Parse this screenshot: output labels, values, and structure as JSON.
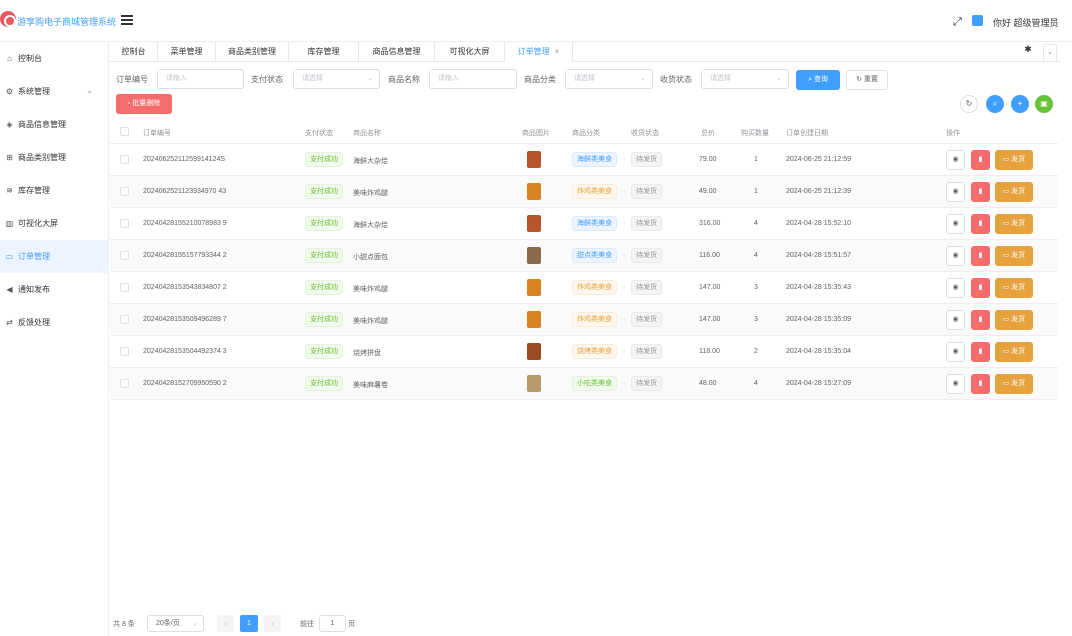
{
  "app": {
    "title": "游享购电子商城管理系统",
    "greeting": "你好 超级管理员"
  },
  "sidebar": {
    "items": [
      {
        "label": "控制台",
        "icon": "home-icon"
      },
      {
        "label": "系统管理",
        "icon": "gear-icon"
      },
      {
        "label": "商品信息管理",
        "icon": "box-icon"
      },
      {
        "label": "商品类别管理",
        "icon": "grid-icon"
      },
      {
        "label": "库存管理",
        "icon": "database-icon"
      },
      {
        "label": "可视化大屏",
        "icon": "chart-icon"
      },
      {
        "label": "订单管理",
        "icon": "card-icon"
      },
      {
        "label": "通知发布",
        "icon": "speaker-icon"
      },
      {
        "label": "反馈处理",
        "icon": "swap-icon"
      }
    ],
    "active": "订单管理"
  },
  "tabs": [
    {
      "label": "控制台"
    },
    {
      "label": "菜单管理"
    },
    {
      "label": "商品类别管理"
    },
    {
      "label": "库存管理"
    },
    {
      "label": "商品信息管理"
    },
    {
      "label": "可视化大屏"
    },
    {
      "label": "订单管理"
    }
  ],
  "filters": {
    "order_no": {
      "label": "订单编号",
      "placeholder": "请输入"
    },
    "pay_status": {
      "label": "支付状态",
      "placeholder": "请选择"
    },
    "product_name": {
      "label": "商品名称",
      "placeholder": "请输入"
    },
    "category": {
      "label": "商品分类",
      "placeholder": "请选择"
    },
    "receive_status": {
      "label": "收货状态",
      "placeholder": "请选择"
    },
    "search_label": "查询",
    "reset_label": "重置"
  },
  "toolbar": {
    "batch_delete_label": "批量删除"
  },
  "table": {
    "columns": [
      "订单编号",
      "支付状态",
      "商品名称",
      "商品图片",
      "商品分类",
      "收货状态",
      "总价",
      "购买数量",
      "订单创建日期",
      "操作"
    ],
    "rows": [
      {
        "order_no": "20240625211259914124S",
        "pay": "支付成功",
        "name": "海鲜大杂烩",
        "category": "海鲜类美食",
        "cat_type": "primary",
        "receive": "待发货",
        "total": "79.00",
        "qty": "1",
        "date": "2024-06-25 21:12:59",
        "img": "#b8542a"
      },
      {
        "order_no": "2024062521123934970 43",
        "pay": "支付成功",
        "name": "美味炸鸡腿",
        "category": "炸鸡类美食",
        "cat_type": "warning",
        "receive": "待发货",
        "total": "49.00",
        "qty": "1",
        "date": "2024-06-25 21:12:39",
        "img": "#d9821f"
      },
      {
        "order_no": "20240428155210078983 9",
        "pay": "支付成功",
        "name": "海鲜大杂烩",
        "category": "海鲜类美食",
        "cat_type": "primary",
        "receive": "待发货",
        "total": "316.00",
        "qty": "4",
        "date": "2024-04-28 15:52:10",
        "img": "#b8542a"
      },
      {
        "order_no": "20240428155157793344 2",
        "pay": "支付成功",
        "name": "小甜点面包",
        "category": "甜点类美食",
        "cat_type": "primary",
        "receive": "待发货",
        "total": "116.00",
        "qty": "4",
        "date": "2024-04-28 15:51:57",
        "img": "#8a6a4a"
      },
      {
        "order_no": "20240428153543834807 2",
        "pay": "支付成功",
        "name": "美味炸鸡腿",
        "category": "炸鸡类美食",
        "cat_type": "warning",
        "receive": "待发货",
        "total": "147.00",
        "qty": "3",
        "date": "2024-04-28 15:35:43",
        "img": "#d9821f"
      },
      {
        "order_no": "20240428153509496289 7",
        "pay": "支付成功",
        "name": "美味炸鸡腿",
        "category": "炸鸡类美食",
        "cat_type": "warning",
        "receive": "待发货",
        "total": "147.00",
        "qty": "3",
        "date": "2024-04-28 15:35:09",
        "img": "#d9821f"
      },
      {
        "order_no": "20240428153504492374 3",
        "pay": "支付成功",
        "name": "烧烤拼盘",
        "category": "烧烤类美食",
        "cat_type": "warning",
        "receive": "待发货",
        "total": "118.00",
        "qty": "2",
        "date": "2024-04-28 15:35:04",
        "img": "#9c4a24"
      },
      {
        "order_no": "20240428152709950590 2",
        "pay": "支付成功",
        "name": "美味麻薯卷",
        "category": "小吃类美食",
        "cat_type": "success",
        "receive": "待发货",
        "total": "48.00",
        "qty": "4",
        "date": "2024-04-28 15:27:09",
        "img": "#b89a6a"
      }
    ],
    "ship_label": "发货"
  },
  "pagination": {
    "total": "共 8 条",
    "page_size": "20条/页",
    "current": "1",
    "goto_prefix": "前往",
    "goto_value": "1",
    "goto_suffix": "页"
  }
}
